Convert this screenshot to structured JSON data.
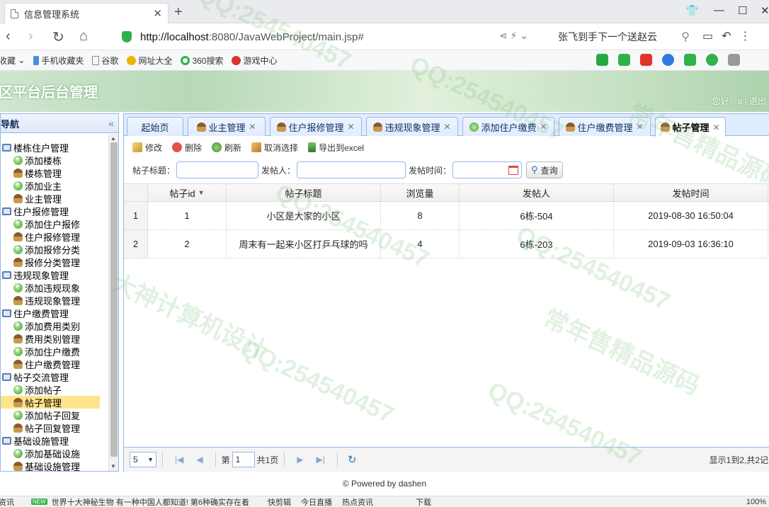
{
  "browser": {
    "tab_title": "信息管理系统",
    "url_host": "http://localhost",
    "url_rest": ":8080/JavaWebProject/main.jsp#",
    "search_text": "张飞到手下一个送赵云",
    "favorites": [
      "收藏",
      "手机收藏夹",
      "谷歌",
      "网址大全",
      "360搜索",
      "游戏中心"
    ]
  },
  "app": {
    "title": "区平台后台管理",
    "greeting": "您好，a | 退出"
  },
  "sidebar": {
    "title": "导航",
    "groups": [
      {
        "label": "楼栋住户管理",
        "items": [
          {
            "label": "添加楼栋",
            "icon": "add"
          },
          {
            "label": "楼栋管理",
            "icon": "user"
          },
          {
            "label": "添加业主",
            "icon": "add"
          },
          {
            "label": "业主管理",
            "icon": "user"
          }
        ]
      },
      {
        "label": "住户报修管理",
        "items": [
          {
            "label": "添加住户报修",
            "icon": "add"
          },
          {
            "label": "住户报修管理",
            "icon": "user"
          },
          {
            "label": "添加报修分类",
            "icon": "add"
          },
          {
            "label": "报修分类管理",
            "icon": "user"
          }
        ]
      },
      {
        "label": "违规现象管理",
        "items": [
          {
            "label": "添加违规现象",
            "icon": "add"
          },
          {
            "label": "违规现象管理",
            "icon": "user"
          }
        ]
      },
      {
        "label": "住户缴费管理",
        "items": [
          {
            "label": "添加费用类别",
            "icon": "add"
          },
          {
            "label": "费用类别管理",
            "icon": "user"
          },
          {
            "label": "添加住户缴费",
            "icon": "add"
          },
          {
            "label": "住户缴费管理",
            "icon": "user"
          }
        ]
      },
      {
        "label": "帖子交流管理",
        "items": [
          {
            "label": "添加帖子",
            "icon": "add"
          },
          {
            "label": "帖子管理",
            "icon": "user",
            "selected": true
          },
          {
            "label": "添加帖子回复",
            "icon": "add"
          },
          {
            "label": "帖子回复管理",
            "icon": "user"
          }
        ]
      },
      {
        "label": "基础设施管理",
        "items": [
          {
            "label": "添加基础设施",
            "icon": "add"
          },
          {
            "label": "基础设施管理",
            "icon": "user"
          }
        ]
      }
    ]
  },
  "tabs": [
    {
      "label": "起始页",
      "closable": false
    },
    {
      "label": "业主管理",
      "closable": true
    },
    {
      "label": "住户报修管理",
      "closable": true
    },
    {
      "label": "违规现象管理",
      "closable": true
    },
    {
      "label": "添加住户缴费",
      "closable": true
    },
    {
      "label": "住户缴费管理",
      "closable": true
    },
    {
      "label": "帖子管理",
      "closable": true,
      "active": true
    }
  ],
  "toolbar": {
    "edit": "修改",
    "delete": "删除",
    "refresh": "刷新",
    "deselect": "取消选择",
    "export": "导出到excel"
  },
  "search": {
    "title_label": "帖子标题：",
    "author_label": "发帖人：",
    "time_label": "发帖时间：",
    "query_button": "查询"
  },
  "grid": {
    "columns": [
      "帖子id",
      "帖子标题",
      "浏览量",
      "发帖人",
      "发帖时间"
    ],
    "rows": [
      {
        "rownum": "1",
        "cells": [
          "1",
          "小区是大家的小区",
          "8",
          "6栋-504",
          "2019-08-30 16:50:04"
        ]
      },
      {
        "rownum": "2",
        "cells": [
          "2",
          "周末有一起来小区打乒乓球的吗",
          "4",
          "6栋-203",
          "2019-09-03 16:36:10"
        ]
      }
    ]
  },
  "pager": {
    "page_size": "5",
    "page_prefix": "第",
    "page_number": "1",
    "page_total": "共1页",
    "info": "显示1到2,共2记"
  },
  "footer": "© Powered by dashen",
  "statusbar": {
    "left": "资讯",
    "badge": "NEW",
    "news": "世界十大神秘生物 有一种中国人都知道! 第6种确实存在着",
    "items": [
      "快剪辑",
      "今日直播",
      "热点资讯",
      "下载",
      "100%"
    ]
  },
  "watermark": [
    "QQ:254540457",
    "常年售精品源码",
    "大神计算机设计"
  ],
  "colors": {
    "accent_border": "#95b8e7",
    "selected_node": "#ffe48d",
    "header_green": "#b6d9b7"
  }
}
